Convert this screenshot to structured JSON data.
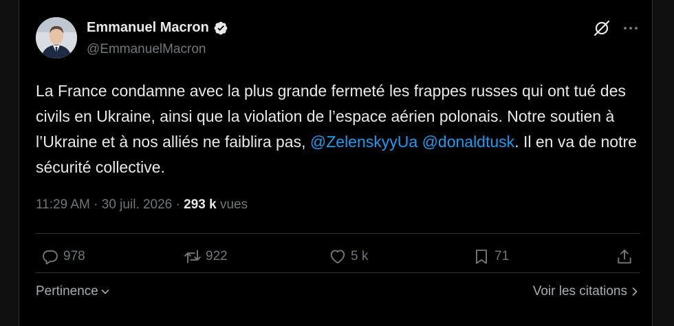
{
  "author": {
    "name": "Emmanuel Macron",
    "handle": "@EmmanuelMacron"
  },
  "tweet": {
    "text_part1": "La France condamne avec la plus grande fermeté les frappes russes qui ont tué des civils en Ukraine, ainsi que la violation de l’espace aérien polonais. Notre soutien à l’Ukraine et à nos alliés ne faiblira pas,",
    "mention1": "@ZelenskyyUa",
    "mention2": "@donaldtusk",
    "text_part2": ". Il en va de notre sécurité collective."
  },
  "meta": {
    "time": "11:29 AM",
    "date": "30 juil. 2026",
    "views_count": "293 k",
    "views_label": "vues"
  },
  "actions": {
    "replies": "978",
    "reposts": "922",
    "likes": "5 k",
    "bookmarks": "71"
  },
  "footer": {
    "sort_label": "Pertinence",
    "quotes_label": "Voir les citations"
  },
  "colors": {
    "accent": "#1d9bf0",
    "muted": "#71767b",
    "text": "#e7e9ea"
  },
  "icons": [
    "reply-icon",
    "repost-icon",
    "like-icon",
    "bookmark-icon",
    "share-icon",
    "grok-icon",
    "more-icon",
    "verified-icon",
    "chevron-down-icon",
    "chevron-right-icon"
  ]
}
